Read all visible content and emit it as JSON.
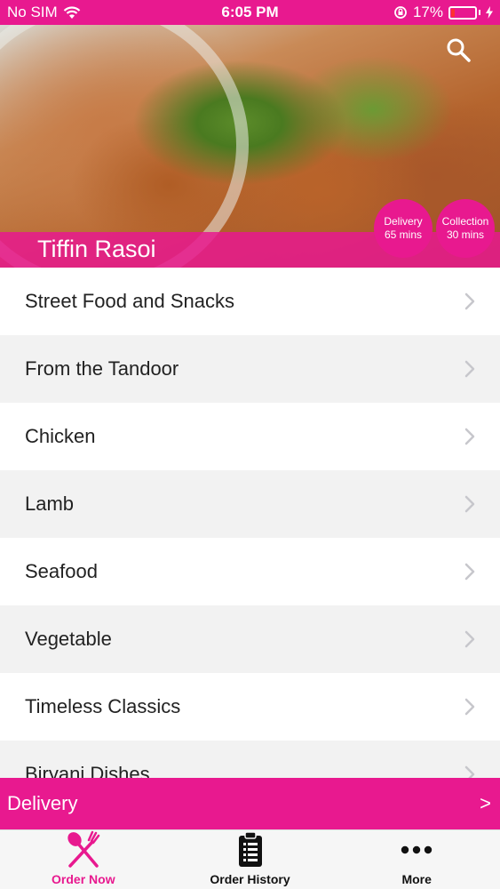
{
  "status_bar": {
    "carrier": "No SIM",
    "time": "6:05 PM",
    "battery": "17%",
    "battery_level": 0.17,
    "icons": [
      "wifi-icon",
      "orientation-lock-icon",
      "battery-icon",
      "charging-icon"
    ]
  },
  "header": {
    "restaurant_name": "Tiffin Rasoi",
    "search_icon": "search-icon",
    "badges": [
      {
        "label": "Delivery",
        "time": "65 mins"
      },
      {
        "label": "Collection",
        "time": "30 mins"
      }
    ]
  },
  "menu": {
    "categories": [
      "Street Food and Snacks",
      "From the Tandoor",
      "Chicken",
      "Lamb",
      "Seafood",
      "Vegetable",
      "Timeless Classics",
      "Biryani Dishes"
    ],
    "chevron_icon": "chevron-right-icon"
  },
  "delivery_bar": {
    "label": "Delivery",
    "arrow": ">"
  },
  "tab_bar": {
    "tabs": [
      {
        "label": "Order Now",
        "icon": "fork-knife-icon",
        "active": true
      },
      {
        "label": "Order History",
        "icon": "clipboard-list-icon",
        "active": false
      },
      {
        "label": "More",
        "icon": "more-dots-icon",
        "active": false
      }
    ]
  },
  "colors": {
    "accent": "#e8198f",
    "tab_active": "#e8198f",
    "row_alt": "#f2f2f2"
  }
}
